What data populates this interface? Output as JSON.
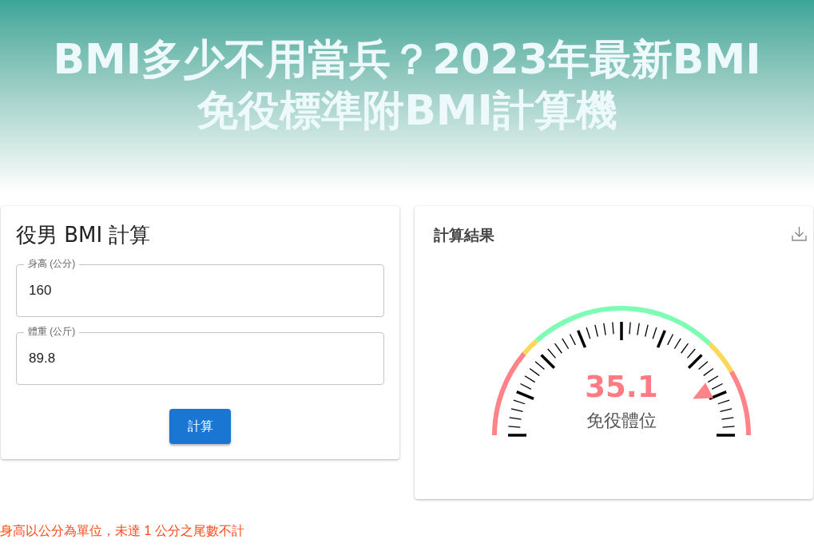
{
  "header": {
    "title_lines": [
      "BMI多少不用當兵？2023年最新BMI",
      "免役標準附BMI計算機"
    ]
  },
  "calculator": {
    "title": "役男 BMI 計算",
    "fields": [
      {
        "label": "身高 (公分)",
        "value": "160"
      },
      {
        "label": "體重 (公斤)",
        "value": "89.8"
      }
    ],
    "button": "計算"
  },
  "result": {
    "title": "計算結果",
    "gauge": {
      "value": "35.1",
      "verdict": "免役體位"
    }
  },
  "note": "身高以公分為單位，未達 1 公分之尾數不計"
}
